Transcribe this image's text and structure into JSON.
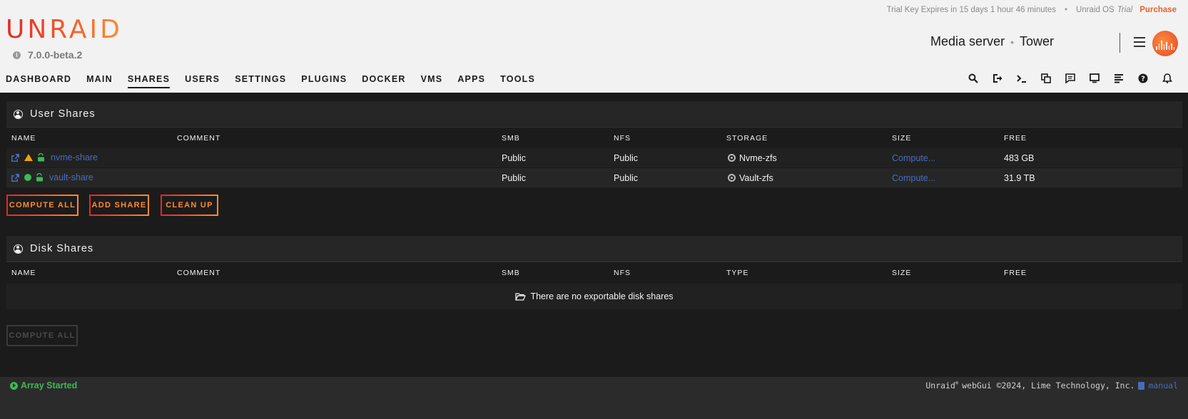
{
  "header": {
    "trial_text": "Trial Key Expires in 15 days 1 hour 46 minutes",
    "os_label": "Unraid OS",
    "os_trial": "Trial",
    "purchase": "Purchase",
    "logo": "UNRAID",
    "version": "7.0.0-beta.2",
    "server_desc": "Media server",
    "server_name": "Tower"
  },
  "nav": {
    "items": [
      {
        "label": "DASHBOARD"
      },
      {
        "label": "MAIN"
      },
      {
        "label": "SHARES"
      },
      {
        "label": "USERS"
      },
      {
        "label": "SETTINGS"
      },
      {
        "label": "PLUGINS"
      },
      {
        "label": "DOCKER"
      },
      {
        "label": "VMS"
      },
      {
        "label": "APPS"
      },
      {
        "label": "TOOLS"
      }
    ],
    "active": "SHARES"
  },
  "user_shares": {
    "title": "User Shares",
    "columns": [
      "NAME",
      "COMMENT",
      "SMB",
      "NFS",
      "STORAGE",
      "SIZE",
      "FREE"
    ],
    "rows": [
      {
        "name": "nvme-share",
        "comment": "",
        "smb": "Public",
        "nfs": "Public",
        "storage": "Nvme-zfs",
        "size": "Compute...",
        "free": "483 GB",
        "status": "warning"
      },
      {
        "name": "vault-share",
        "comment": "",
        "smb": "Public",
        "nfs": "Public",
        "storage": "Vault-zfs",
        "size": "Compute...",
        "free": "31.9 TB",
        "status": "ok"
      }
    ],
    "buttons": {
      "compute_all": "COMPUTE ALL",
      "add_share": "ADD SHARE",
      "clean_up": "CLEAN UP"
    }
  },
  "disk_shares": {
    "title": "Disk Shares",
    "columns": [
      "NAME",
      "COMMENT",
      "SMB",
      "NFS",
      "TYPE",
      "SIZE",
      "FREE"
    ],
    "empty_message": "There are no exportable disk shares",
    "buttons": {
      "compute_all": "COMPUTE ALL"
    }
  },
  "footer": {
    "array_status": "Array Started",
    "copyright_brand": "Unraid",
    "copyright_reg": "®",
    "copyright_text": "webGui ©2024, Lime Technology, Inc.",
    "manual": "manual"
  },
  "colors": {
    "accent": "#ff8c2f",
    "accent_red": "#e22828",
    "link": "#486dba",
    "ok": "#3cba54",
    "warning": "#f0a30a"
  }
}
